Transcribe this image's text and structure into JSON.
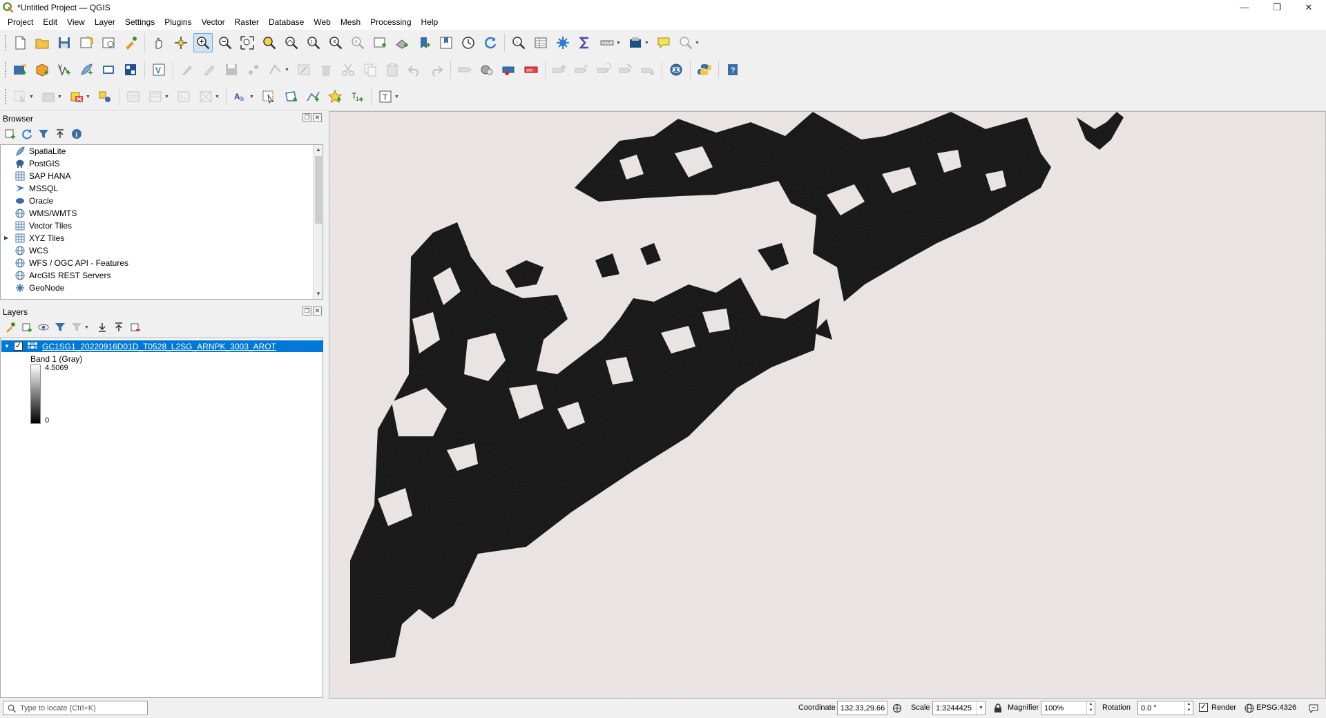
{
  "window": {
    "title": "*Untitled Project — QGIS",
    "minimize": "—",
    "restore": "❐",
    "close": "✕"
  },
  "menus": [
    "Project",
    "Edit",
    "View",
    "Layer",
    "Settings",
    "Plugins",
    "Vector",
    "Raster",
    "Database",
    "Web",
    "Mesh",
    "Processing",
    "Help"
  ],
  "browser": {
    "title": "Browser",
    "items": [
      {
        "label": "SpatiaLite",
        "icon": "feather-icon",
        "expandable": false
      },
      {
        "label": "PostGIS",
        "icon": "elephant-icon",
        "expandable": false
      },
      {
        "label": "SAP HANA",
        "icon": "grid-db-icon",
        "expandable": false
      },
      {
        "label": "MSSQL",
        "icon": "mssql-icon",
        "expandable": false
      },
      {
        "label": "Oracle",
        "icon": "oracle-icon",
        "expandable": false
      },
      {
        "label": "WMS/WMTS",
        "icon": "globe-icon",
        "expandable": false
      },
      {
        "label": "Vector Tiles",
        "icon": "tiles-icon",
        "expandable": false
      },
      {
        "label": "XYZ Tiles",
        "icon": "tiles-icon",
        "expandable": true
      },
      {
        "label": "WCS",
        "icon": "globe-icon",
        "expandable": false
      },
      {
        "label": "WFS / OGC API - Features",
        "icon": "globe-icon",
        "expandable": false
      },
      {
        "label": "ArcGIS REST Servers",
        "icon": "globe-icon",
        "expandable": false
      },
      {
        "label": "GeoNode",
        "icon": "geonode-icon",
        "expandable": false
      }
    ]
  },
  "layers": {
    "title": "Layers",
    "layer_name": "GC1SG1_20220916D01D_T0528_L2SG_ARNPK_3003_AROT",
    "checked": "✓",
    "band_label": "Band 1 (Gray)",
    "legend_max": "4.5069",
    "legend_min": "0"
  },
  "statusbar": {
    "locator_placeholder": "Type to locate (Ctrl+K)",
    "coordinate_label": "Coordinate",
    "coordinate_value": "132.33,29.66",
    "scale_label": "Scale",
    "scale_value": "1:3244425",
    "magnifier_label": "Magnifier",
    "magnifier_value": "100%",
    "rotation_label": "Rotation",
    "rotation_value": "0.0 °",
    "render_label": "Render",
    "render_checked": "✓",
    "crs_value": "EPSG:4326"
  },
  "colors": {
    "selection": "#0078d7",
    "map_background": "#e8e2e2",
    "raster_dark": "#0e0e0e"
  }
}
